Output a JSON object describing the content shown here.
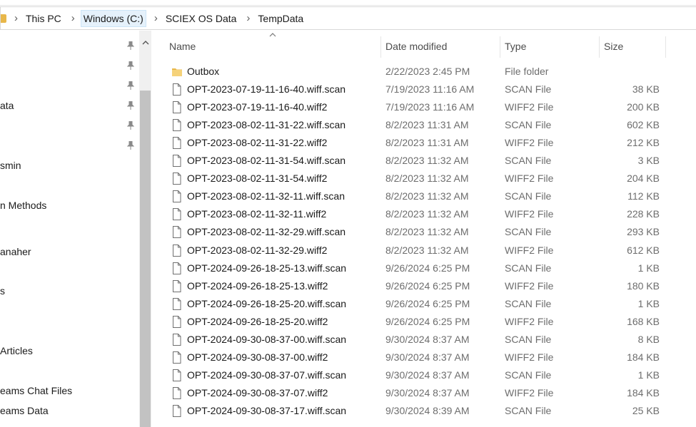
{
  "breadcrumb": {
    "items": [
      "This PC",
      "Windows (C:)",
      "SCIEX OS Data",
      "TempData"
    ],
    "separator": "›"
  },
  "nav": {
    "items": [
      "ata",
      "smin",
      "n Methods",
      "anaher",
      "s",
      "Articles",
      "eams Chat Files",
      "eams Data"
    ]
  },
  "columns": {
    "name": "Name",
    "date": "Date modified",
    "type": "Type",
    "size": "Size"
  },
  "files": [
    {
      "icon": "folder-icon",
      "name": "Outbox",
      "date": "2/22/2023 2:45 PM",
      "type": "File folder",
      "size": ""
    },
    {
      "icon": "file-icon",
      "name": "OPT-2023-07-19-11-16-40.wiff.scan",
      "date": "7/19/2023 11:16 AM",
      "type": "SCAN File",
      "size": "38 KB"
    },
    {
      "icon": "file-icon",
      "name": "OPT-2023-07-19-11-16-40.wiff2",
      "date": "7/19/2023 11:16 AM",
      "type": "WIFF2 File",
      "size": "200 KB"
    },
    {
      "icon": "file-icon",
      "name": "OPT-2023-08-02-11-31-22.wiff.scan",
      "date": "8/2/2023 11:31 AM",
      "type": "SCAN File",
      "size": "602 KB"
    },
    {
      "icon": "file-icon",
      "name": "OPT-2023-08-02-11-31-22.wiff2",
      "date": "8/2/2023 11:31 AM",
      "type": "WIFF2 File",
      "size": "212 KB"
    },
    {
      "icon": "file-icon",
      "name": "OPT-2023-08-02-11-31-54.wiff.scan",
      "date": "8/2/2023 11:32 AM",
      "type": "SCAN File",
      "size": "3 KB"
    },
    {
      "icon": "file-icon",
      "name": "OPT-2023-08-02-11-31-54.wiff2",
      "date": "8/2/2023 11:32 AM",
      "type": "WIFF2 File",
      "size": "204 KB"
    },
    {
      "icon": "file-icon",
      "name": "OPT-2023-08-02-11-32-11.wiff.scan",
      "date": "8/2/2023 11:32 AM",
      "type": "SCAN File",
      "size": "112 KB"
    },
    {
      "icon": "file-icon",
      "name": "OPT-2023-08-02-11-32-11.wiff2",
      "date": "8/2/2023 11:32 AM",
      "type": "WIFF2 File",
      "size": "228 KB"
    },
    {
      "icon": "file-icon",
      "name": "OPT-2023-08-02-11-32-29.wiff.scan",
      "date": "8/2/2023 11:32 AM",
      "type": "SCAN File",
      "size": "293 KB"
    },
    {
      "icon": "file-icon",
      "name": "OPT-2023-08-02-11-32-29.wiff2",
      "date": "8/2/2023 11:32 AM",
      "type": "WIFF2 File",
      "size": "612 KB"
    },
    {
      "icon": "file-icon",
      "name": "OPT-2024-09-26-18-25-13.wiff.scan",
      "date": "9/26/2024 6:25 PM",
      "type": "SCAN File",
      "size": "1 KB"
    },
    {
      "icon": "file-icon",
      "name": "OPT-2024-09-26-18-25-13.wiff2",
      "date": "9/26/2024 6:25 PM",
      "type": "WIFF2 File",
      "size": "180 KB"
    },
    {
      "icon": "file-icon",
      "name": "OPT-2024-09-26-18-25-20.wiff.scan",
      "date": "9/26/2024 6:25 PM",
      "type": "SCAN File",
      "size": "1 KB"
    },
    {
      "icon": "file-icon",
      "name": "OPT-2024-09-26-18-25-20.wiff2",
      "date": "9/26/2024 6:25 PM",
      "type": "WIFF2 File",
      "size": "168 KB"
    },
    {
      "icon": "file-icon",
      "name": "OPT-2024-09-30-08-37-00.wiff.scan",
      "date": "9/30/2024 8:37 AM",
      "type": "SCAN File",
      "size": "8 KB"
    },
    {
      "icon": "file-icon",
      "name": "OPT-2024-09-30-08-37-00.wiff2",
      "date": "9/30/2024 8:37 AM",
      "type": "WIFF2 File",
      "size": "184 KB"
    },
    {
      "icon": "file-icon",
      "name": "OPT-2024-09-30-08-37-07.wiff.scan",
      "date": "9/30/2024 8:37 AM",
      "type": "SCAN File",
      "size": "1 KB"
    },
    {
      "icon": "file-icon",
      "name": "OPT-2024-09-30-08-37-07.wiff2",
      "date": "9/30/2024 8:37 AM",
      "type": "WIFF2 File",
      "size": "184 KB"
    },
    {
      "icon": "file-icon",
      "name": "OPT-2024-09-30-08-37-17.wiff.scan",
      "date": "9/30/2024 8:39 AM",
      "type": "SCAN File",
      "size": "25 KB"
    }
  ],
  "colors": {
    "folder": "#e8b74a",
    "breadcrumb_highlight": "#e5f1fb",
    "scroll_thumb": "#c2c2c2"
  }
}
